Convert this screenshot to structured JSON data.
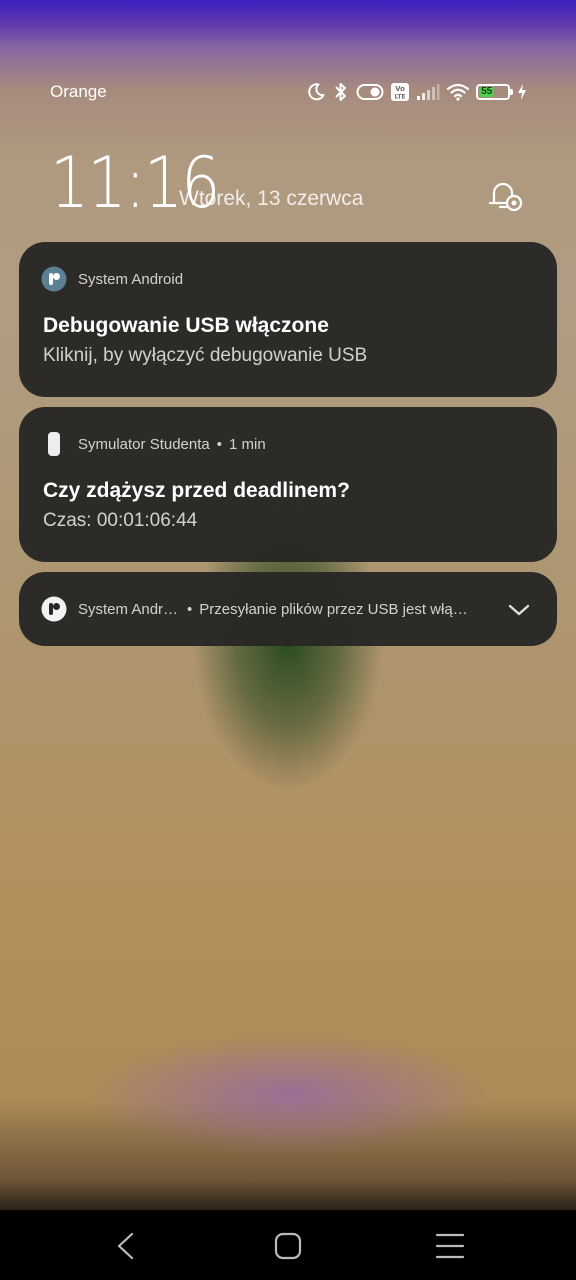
{
  "status_bar": {
    "carrier": "Orange",
    "battery_level": "55",
    "icons": [
      "moon-icon",
      "bluetooth-icon",
      "toggle-icon",
      "volte-icon",
      "signal-icon",
      "wifi-icon",
      "battery-icon",
      "charging-icon"
    ],
    "volte_label": "Vo\nLTE"
  },
  "lock_screen": {
    "time": "11:16",
    "date": "Wtorek, 13 czerwca"
  },
  "notifications": [
    {
      "app": "System Android",
      "title": "Debugowanie USB włączone",
      "text": "Kliknij, by wyłączyć debugowanie USB"
    },
    {
      "app": "Symulator Studenta",
      "time": "1 min",
      "title": "Czy zdążysz przed deadlinem?",
      "text": "Czas: 00:01:06:44"
    },
    {
      "app": "System Andr…",
      "text": "Przesyłanie plików przez USB jest włą…"
    }
  ],
  "colors": {
    "card_background": "#282624",
    "battery_fill": "#4fd14f",
    "nav_bar": "#000000"
  }
}
